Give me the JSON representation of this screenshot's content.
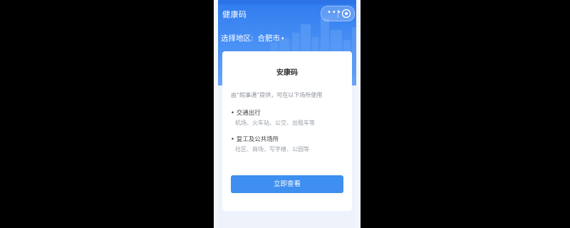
{
  "app": {
    "title": "健康码"
  },
  "header": {
    "more_icon": "more-icon",
    "close_icon": "target-close-icon"
  },
  "region": {
    "label": "选择地区:",
    "city": "合肥市",
    "caret": "▾"
  },
  "card": {
    "title": "安康码",
    "provider_text": "由“皖事通”提供，可在以下场所使用",
    "categories": [
      {
        "title": "• 交通出行",
        "desc": "机场、火车站、公交、出租车等"
      },
      {
        "title": "• 复工及公共场所",
        "desc": "社区、商场、写字楼、公园等"
      }
    ],
    "button_label": "立即查看"
  },
  "colors": {
    "primary": "#3e8ff0",
    "hero": "#2f7bef",
    "background": "#eef3fb"
  }
}
